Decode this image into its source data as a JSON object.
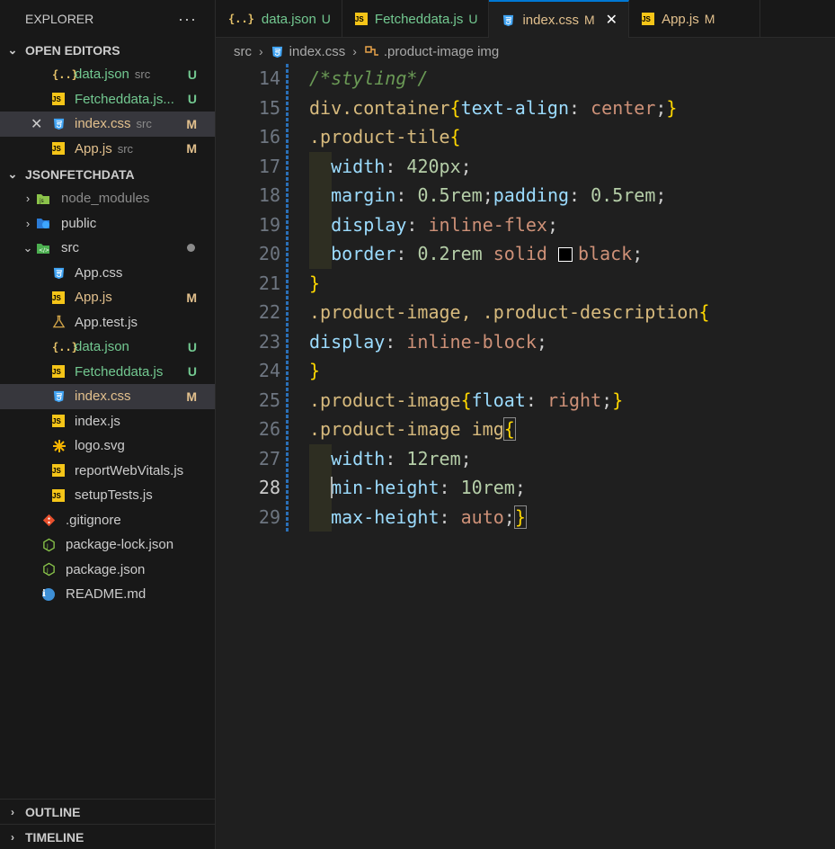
{
  "explorer": {
    "title": "EXPLORER",
    "more": "···",
    "open_editors_title": "OPEN EDITORS",
    "open_editors": [
      {
        "name": "data.json",
        "dir": "src",
        "status": "U",
        "icon": "json-icon"
      },
      {
        "name": "Fetcheddata.js...",
        "dir": "",
        "status": "U",
        "icon": "js-icon"
      },
      {
        "name": "index.css",
        "dir": "src",
        "status": "M",
        "icon": "css-icon"
      },
      {
        "name": "App.js",
        "dir": "src",
        "status": "M",
        "icon": "js-icon"
      }
    ],
    "project_title": "JSONFETCHDATA",
    "tree": {
      "node_modules": "node_modules",
      "public": "public",
      "src": "src",
      "src_files": [
        {
          "name": "App.css",
          "status": "",
          "icon": "css-icon"
        },
        {
          "name": "App.js",
          "status": "M",
          "icon": "js-icon"
        },
        {
          "name": "App.test.js",
          "status": "",
          "icon": "flask-icon"
        },
        {
          "name": "data.json",
          "status": "U",
          "icon": "json-icon"
        },
        {
          "name": "Fetcheddata.js",
          "status": "U",
          "icon": "js-icon"
        },
        {
          "name": "index.css",
          "status": "M",
          "icon": "css-icon"
        },
        {
          "name": "index.js",
          "status": "",
          "icon": "js-icon"
        },
        {
          "name": "logo.svg",
          "status": "",
          "icon": "svg-icon"
        },
        {
          "name": "reportWebVitals.js",
          "status": "",
          "icon": "js-icon"
        },
        {
          "name": "setupTests.js",
          "status": "",
          "icon": "js-icon"
        }
      ],
      "root_files": [
        {
          "name": ".gitignore",
          "icon": "git-icon"
        },
        {
          "name": "package-lock.json",
          "icon": "nodejs-icon"
        },
        {
          "name": "package.json",
          "icon": "nodejs-icon"
        },
        {
          "name": "README.md",
          "icon": "info-icon"
        }
      ]
    },
    "outline_title": "OUTLINE",
    "timeline_title": "TIMELINE"
  },
  "tabs": [
    {
      "label": "data.json",
      "status": "U",
      "icon": "json-icon"
    },
    {
      "label": "Fetcheddata.js",
      "status": "U",
      "icon": "js-icon"
    },
    {
      "label": "index.css",
      "status": "M",
      "icon": "css-icon",
      "active": true
    },
    {
      "label": "App.js",
      "status": "M",
      "icon": "js-icon"
    }
  ],
  "breadcrumb": {
    "folder": "src",
    "file": "index.css",
    "symbol": ".product-image img"
  },
  "editor": {
    "current_line": 28,
    "lines": [
      {
        "num": "14",
        "tokens": [
          [
            "com",
            "/*styling*/"
          ]
        ]
      },
      {
        "num": "15",
        "tokens": [
          [
            "sel",
            "div.container"
          ],
          [
            "br",
            "{"
          ],
          [
            "prop",
            "text-align"
          ],
          [
            "p",
            ": "
          ],
          [
            "val",
            "center"
          ],
          [
            "p",
            ";"
          ],
          [
            "br",
            "}"
          ]
        ]
      },
      {
        "num": "16",
        "tokens": [
          [
            "sel",
            ".product-tile"
          ],
          [
            "br",
            "{"
          ]
        ]
      },
      {
        "num": "17",
        "tokens": [
          [
            "p",
            "  "
          ],
          [
            "prop",
            "width"
          ],
          [
            "p",
            ": "
          ],
          [
            "num",
            "420px"
          ],
          [
            "p",
            ";"
          ]
        ]
      },
      {
        "num": "18",
        "tokens": [
          [
            "p",
            "  "
          ],
          [
            "prop",
            "margin"
          ],
          [
            "p",
            ": "
          ],
          [
            "num",
            "0.5rem"
          ],
          [
            "p",
            ";"
          ],
          [
            "prop",
            "padding"
          ],
          [
            "p",
            ": "
          ],
          [
            "num",
            "0.5rem"
          ],
          [
            "p",
            ";"
          ]
        ]
      },
      {
        "num": "19",
        "tokens": [
          [
            "p",
            "  "
          ],
          [
            "prop",
            "display"
          ],
          [
            "p",
            ": "
          ],
          [
            "val",
            "inline-flex"
          ],
          [
            "p",
            ";"
          ]
        ]
      },
      {
        "num": "20",
        "tokens": [
          [
            "p",
            "  "
          ],
          [
            "prop",
            "border"
          ],
          [
            "p",
            ": "
          ],
          [
            "num",
            "0.2rem"
          ],
          [
            "p",
            " "
          ],
          [
            "val",
            "solid"
          ],
          [
            "p",
            " "
          ],
          [
            "swatch",
            ""
          ],
          [
            "val",
            "black"
          ],
          [
            "p",
            ";"
          ]
        ]
      },
      {
        "num": "21",
        "tokens": [
          [
            "br",
            "}"
          ]
        ]
      },
      {
        "num": "22",
        "tokens": [
          [
            "sel",
            ".product-image, .product-description"
          ],
          [
            "br",
            "{"
          ]
        ]
      },
      {
        "num": "23",
        "tokens": [
          [
            "prop",
            "display"
          ],
          [
            "p",
            ": "
          ],
          [
            "val",
            "inline-block"
          ],
          [
            "p",
            ";"
          ]
        ]
      },
      {
        "num": "24",
        "tokens": [
          [
            "br",
            "}"
          ]
        ]
      },
      {
        "num": "25",
        "tokens": [
          [
            "sel",
            ".product-image"
          ],
          [
            "br",
            "{"
          ],
          [
            "prop",
            "float"
          ],
          [
            "p",
            ": "
          ],
          [
            "val",
            "right"
          ],
          [
            "p",
            ";"
          ],
          [
            "br",
            "}"
          ]
        ]
      },
      {
        "num": "26",
        "tokens": [
          [
            "sel",
            ".product-image img"
          ],
          [
            "brbox",
            "{"
          ]
        ]
      },
      {
        "num": "27",
        "tokens": [
          [
            "p",
            "  "
          ],
          [
            "prop",
            "width"
          ],
          [
            "p",
            ": "
          ],
          [
            "num",
            "12rem"
          ],
          [
            "p",
            ";"
          ]
        ]
      },
      {
        "num": "28",
        "tokens": [
          [
            "p",
            "  "
          ],
          [
            "prop",
            "min-height"
          ],
          [
            "p",
            ": "
          ],
          [
            "num",
            "10rem"
          ],
          [
            "p",
            ";"
          ]
        ]
      },
      {
        "num": "29",
        "tokens": [
          [
            "p",
            "  "
          ],
          [
            "prop",
            "max-height"
          ],
          [
            "p",
            ": "
          ],
          [
            "val",
            "auto"
          ],
          [
            "p",
            ";"
          ],
          [
            "brbox",
            "}"
          ]
        ]
      }
    ]
  }
}
